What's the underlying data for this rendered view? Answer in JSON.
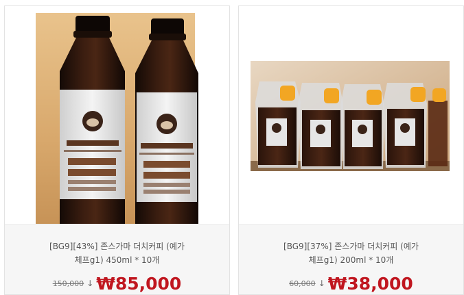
{
  "products": [
    {
      "title_line1": "[BG9][43%] 존스가마 더치커피 (예가",
      "title_line2": "체프g1) 450ml * 10개",
      "old_price": "150,000",
      "arrow": "↓",
      "new_price": "₩85,000",
      "image": {
        "type": "bottle-photo",
        "label_brand": "존스가마생각로스팅",
        "label_lines": [
          "더치커피",
          "2015"
        ]
      }
    },
    {
      "title_line1": "[BG9][37%] 존스가마 더치커피 (예가",
      "title_line2": "체프g1) 200ml * 10개",
      "old_price": "60,000",
      "arrow": "↓",
      "new_price": "₩38,000",
      "image": {
        "type": "pouch-photo"
      }
    }
  ],
  "colors": {
    "price_red": "#c0161f",
    "card_border": "#e3e3e3",
    "info_bg": "#f6f6f6"
  }
}
